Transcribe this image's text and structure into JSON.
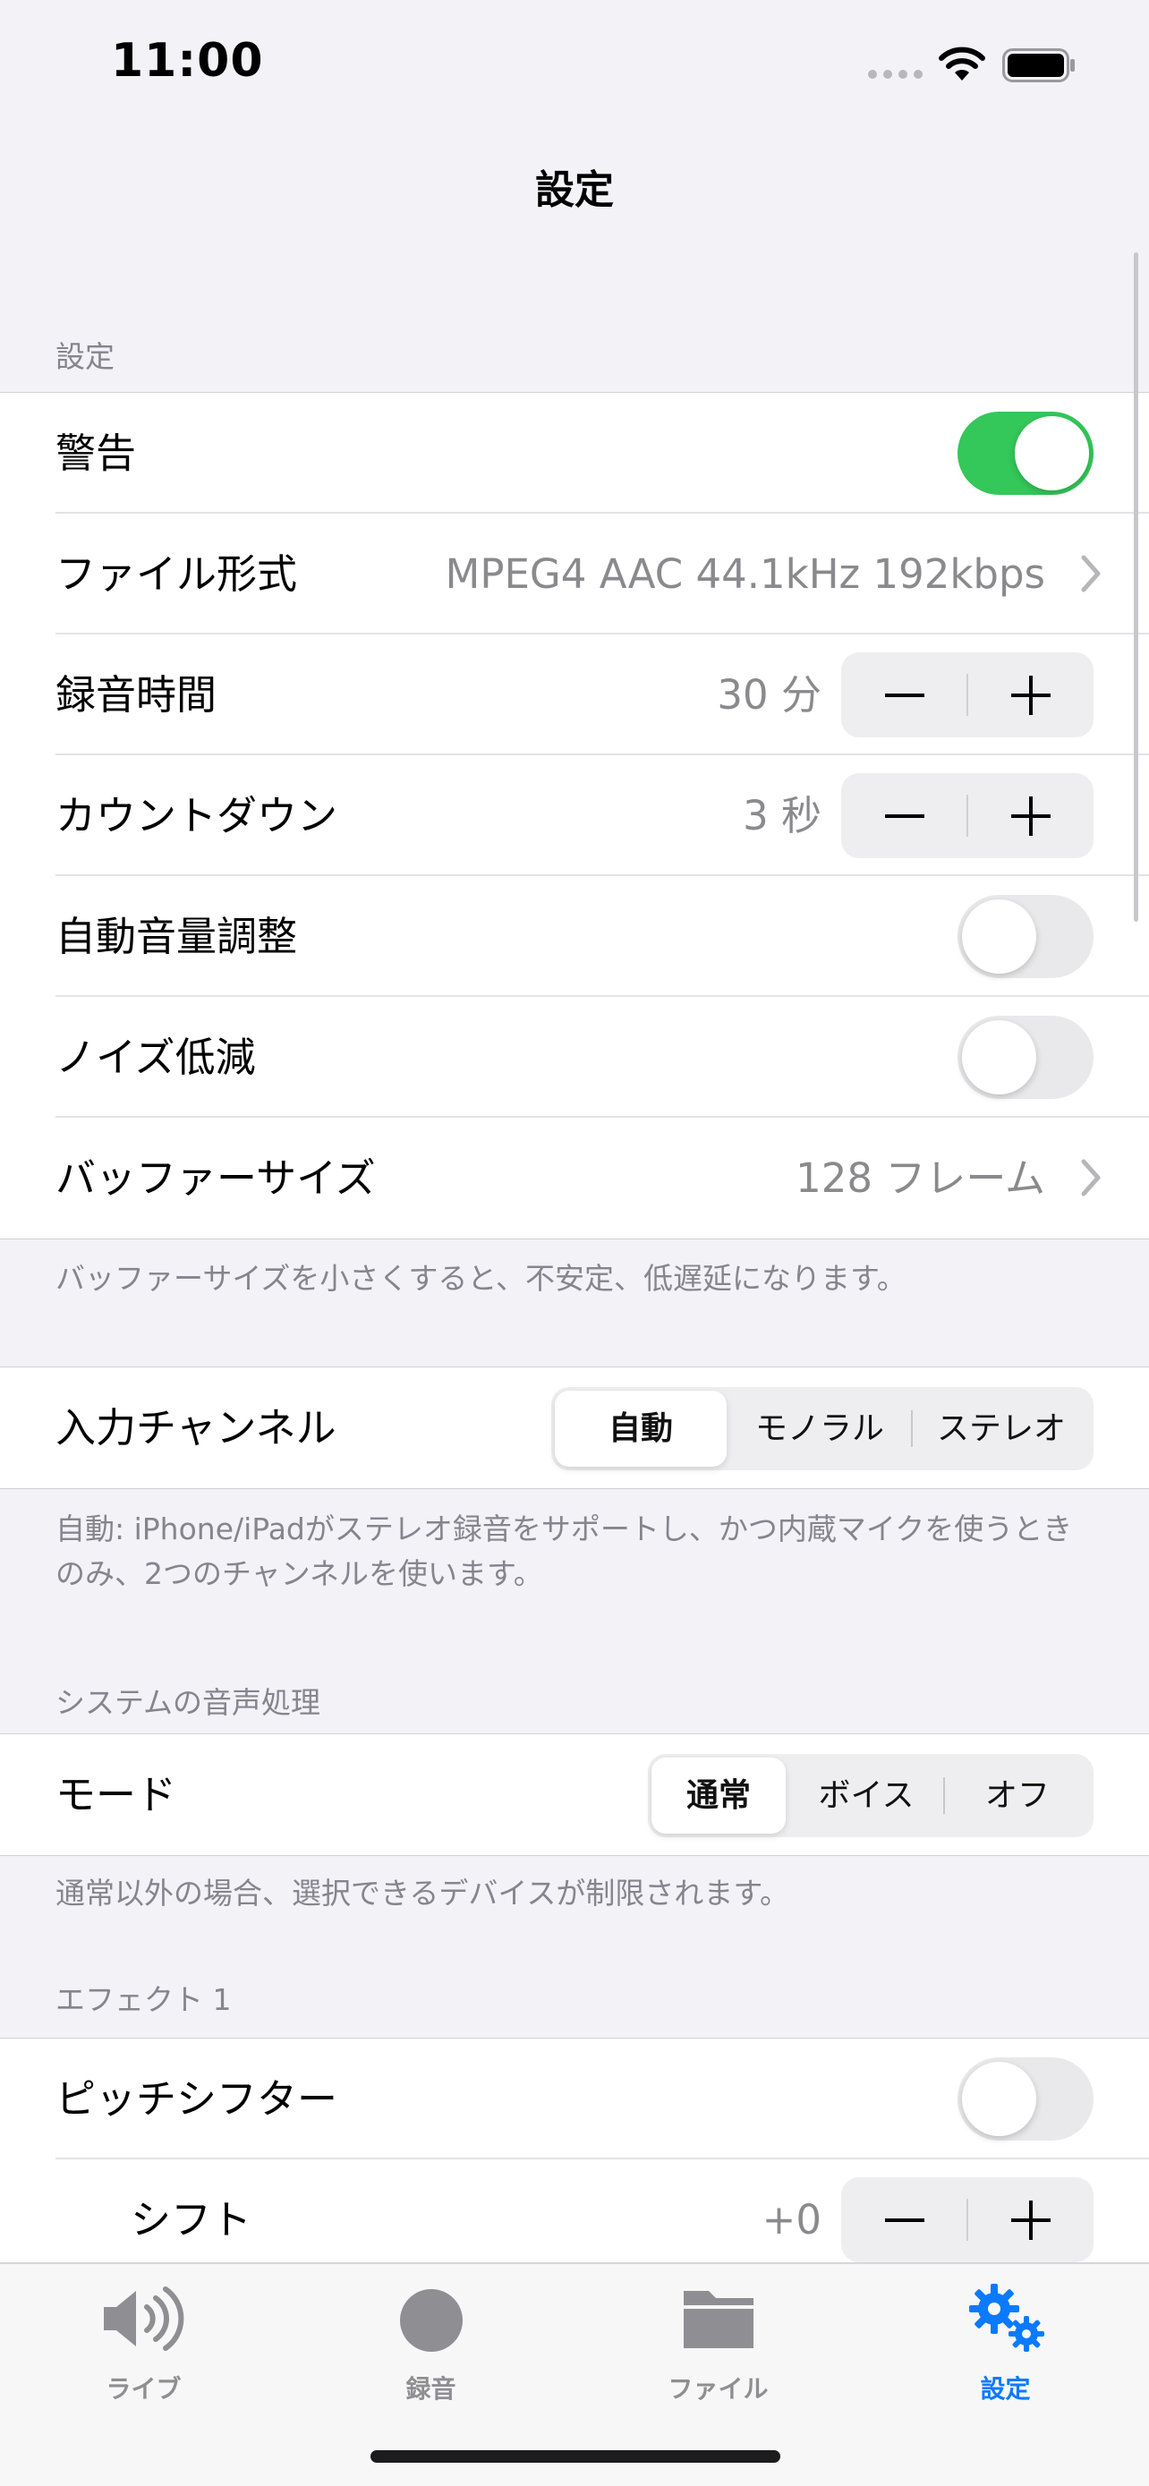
{
  "status": {
    "time": "11:00"
  },
  "nav": {
    "title": "設定"
  },
  "settings": {
    "header": "設定",
    "rows": {
      "alert": {
        "label": "警告",
        "on": true
      },
      "file_format": {
        "label": "ファイル形式",
        "value": "MPEG4 AAC 44.1kHz 192kbps"
      },
      "rec_time": {
        "label": "録音時間",
        "value": "30 分"
      },
      "countdown": {
        "label": "カウントダウン",
        "value": "3 秒"
      },
      "auto_gain": {
        "label": "自動音量調整",
        "on": false
      },
      "noise_reduction": {
        "label": "ノイズ低減",
        "on": false
      },
      "buffer_size": {
        "label": "バッファーサイズ",
        "value": "128 フレーム"
      }
    },
    "footer": "バッファーサイズを小さくすると、不安定、低遅延になります。"
  },
  "input_channel": {
    "label": "入力チャンネル",
    "options": [
      "自動",
      "モノラル",
      "ステレオ"
    ],
    "selected": "自動",
    "footer": "自動: iPhone/iPadがステレオ録音をサポートし、かつ内蔵マイクを使うときのみ、2つのチャンネルを使います。"
  },
  "system_audio": {
    "header": "システムの音声処理",
    "mode_label": "モード",
    "options": [
      "通常",
      "ボイス",
      "オフ"
    ],
    "selected": "通常",
    "footer": "通常以外の場合、選択できるデバイスが制限されます。"
  },
  "effect1": {
    "header": "エフェクト 1",
    "pitch_shifter": {
      "label": "ピッチシフター",
      "on": false
    },
    "shift": {
      "label": "シフト",
      "value": "+0"
    }
  },
  "tabbar": {
    "items": [
      {
        "label": "ライブ",
        "icon": "speaker-wave-icon",
        "active": false
      },
      {
        "label": "録音",
        "icon": "record-circle-icon",
        "active": false
      },
      {
        "label": "ファイル",
        "icon": "folder-icon",
        "active": false
      },
      {
        "label": "設定",
        "icon": "gears-icon",
        "active": true
      }
    ]
  },
  "colors": {
    "accent": "#0A7AFF",
    "toggle_on": "#34C759",
    "secondary_text": "#8A8A8E",
    "background": "#F2F2F7"
  }
}
